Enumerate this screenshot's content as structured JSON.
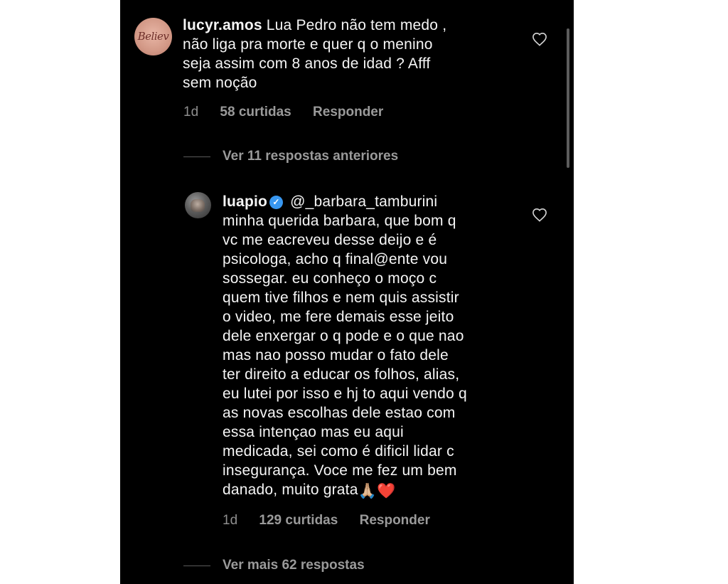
{
  "comments": [
    {
      "username": "lucyr.amos",
      "avatar_text": "Believ",
      "text": " Lua Pedro não tem medo ,\nnão liga pra morte e quer q o menino\nseja assim com 8 anos de idad ? Afff\nsem noção",
      "time": "1d",
      "likes": "58 curtidas",
      "reply_label": "Responder",
      "view_replies": "Ver 11 respostas anteriores"
    },
    {
      "username": "luapio",
      "verified": true,
      "mention": " @_barbara_tamburini",
      "text": "minha querida barbara, que bom q\nvc me eacreveu desse deijo e é\npsicologa, acho q final@ente vou\nsossegar. eu conheço o moço c\nquem tive filhos e nem quis assistir\no video, me fere demais esse jeito\ndele enxergar o q pode e o que nao\nmas nao posso mudar o fato dele\nter direito a educar os folhos, alias,\neu lutei por isso e hj to aqui vendo q\nas novas escolhas dele estao com\nessa intençao mas eu aqui\nmedicada, sei como é dificil lidar c\ninsegurança. Voce me fez um bem\ndanado, muito grata",
      "emoji_hands": "🙏🏼",
      "emoji_heart": "❤️",
      "time": "1d",
      "likes": "129 curtidas",
      "reply_label": "Responder",
      "view_more": "Ver mais 62 respostas"
    }
  ],
  "colors": {
    "background": "#000000",
    "text": "#f5f5f5",
    "meta": "#8e8e8e",
    "verified": "#3897f0"
  }
}
